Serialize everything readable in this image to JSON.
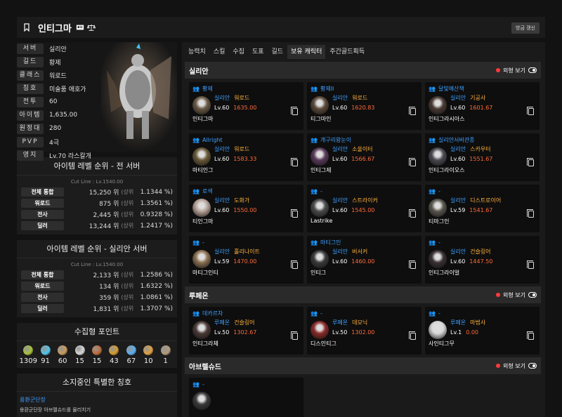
{
  "header": {
    "title": "인티그마",
    "refresh_label": "방금 갱신"
  },
  "profile": {
    "rows": [
      {
        "label": "서버",
        "value": "실리안"
      },
      {
        "label": "길드",
        "value": "황제"
      },
      {
        "label": "클래스",
        "value": "워로드"
      },
      {
        "label": "칭호",
        "value": "미술품 애호가"
      },
      {
        "label": "전투",
        "value": "60"
      },
      {
        "label": "아이템",
        "value": "1,635.00"
      },
      {
        "label": "원정대",
        "value": "280"
      },
      {
        "label": "PVP",
        "value": "4극"
      },
      {
        "label": "영지",
        "value": "Lv.70 라스칼개"
      }
    ]
  },
  "rank_all": {
    "title": "아이템 레벨 순위 - 전 서버",
    "cutline": "Cut Line : Lv.1540.00",
    "rows": [
      {
        "label": "전체 통합",
        "rank": "15,250 위",
        "tier": "(상위",
        "pct": "1.1344 %)"
      },
      {
        "label": "워로드",
        "rank": "875 위",
        "tier": "(상위",
        "pct": "1.3561 %)"
      },
      {
        "label": "전사",
        "rank": "2,445 위",
        "tier": "(상위",
        "pct": "0.9328 %)"
      },
      {
        "label": "딜러",
        "rank": "13,244 위",
        "tier": "(상위",
        "pct": "1.2417 %)"
      }
    ]
  },
  "rank_server": {
    "title": "아이템 레벨 순위 - 실리안 서버",
    "cutline": "Cut Line : Lv.1540.00",
    "rows": [
      {
        "label": "전체 통합",
        "rank": "2,133 위",
        "tier": "(상위",
        "pct": "1.2586 %)"
      },
      {
        "label": "워로드",
        "rank": "134 위",
        "tier": "(상위",
        "pct": "1.6322 %)"
      },
      {
        "label": "전사",
        "rank": "359 위",
        "tier": "(상위",
        "pct": "1.0861 %)"
      },
      {
        "label": "딜러",
        "rank": "1,831 위",
        "tier": "(상위",
        "pct": "1.3707 %)"
      }
    ]
  },
  "collection": {
    "title": "수집형 포인트",
    "items": [
      {
        "icon": "mokoko-seed-icon",
        "color": "#a8c23a",
        "value": "1309"
      },
      {
        "icon": "island-heart-icon",
        "color": "#4fc4e8",
        "value": "91"
      },
      {
        "icon": "masterpiece-icon",
        "color": "#c99a5a",
        "value": "60"
      },
      {
        "icon": "giant-heart-icon",
        "color": "#d7d7d7",
        "value": "15"
      },
      {
        "icon": "ignea-token-icon",
        "color": "#c06a3a",
        "value": "15"
      },
      {
        "icon": "sea-bounty-icon",
        "color": "#d69a2a",
        "value": "43"
      },
      {
        "icon": "world-tree-leaf-icon",
        "color": "#5ab0f0",
        "value": "67"
      },
      {
        "icon": "orpheus-star-icon",
        "color": "#e0a040",
        "value": "10"
      },
      {
        "icon": "omnium-star-icon",
        "color": "#b49a7a",
        "value": "1"
      }
    ]
  },
  "special_titles": {
    "title": "소지중인 특별한 칭호",
    "items": [
      {
        "name": "용환군단장",
        "desc": "용환군단장 아브렐슈드를 물리치기"
      }
    ]
  },
  "tabs": [
    "능력치",
    "스킬",
    "수집",
    "도표",
    "길드",
    "보유 캐릭터",
    "주간골드획득"
  ],
  "active_tab": "보유 캐릭터",
  "view_label": "외형 보기",
  "servers": [
    {
      "name": "실리안",
      "characters": [
        {
          "guild": "황제",
          "server": "실리안",
          "class": "워로드",
          "level": "Lv.60",
          "ilvl": "1635.00",
          "name": "인티그마",
          "avatar_color": "#6a5a46"
        },
        {
          "guild": "황제II",
          "server": "실리안",
          "class": "워로드",
          "level": "Lv.60",
          "ilvl": "1620.83",
          "name": "티그마인",
          "avatar_color": "#5a4a3a"
        },
        {
          "guild": "달빛예산책",
          "server": "실리안",
          "class": "기공사",
          "level": "Lv.60",
          "ilvl": "1601.67",
          "name": "인티그라시아스",
          "avatar_color": "#4a3a34"
        },
        {
          "guild": "Allright",
          "server": "실리안",
          "class": "워로드",
          "level": "Lv.60",
          "ilvl": "1583.33",
          "name": "마티인그",
          "avatar_color": "#6a5a3a"
        },
        {
          "guild": "개구리왕눈이",
          "server": "실리안",
          "class": "소울이터",
          "level": "Lv.60",
          "ilvl": "1566.67",
          "name": "인티그제",
          "avatar_color": "#5a3a5a"
        },
        {
          "guild": "실리안서버관종",
          "server": "실리안",
          "class": "스카우터",
          "level": "Lv.60",
          "ilvl": "1551.67",
          "name": "인티그라이오스",
          "avatar_color": "#4a4a52"
        },
        {
          "guild": "로섹",
          "server": "실리안",
          "class": "도화가",
          "level": "Lv.60",
          "ilvl": "1550.00",
          "name": "티인그마",
          "avatar_color": "#b8a49a"
        },
        {
          "guild": "-",
          "server": "실리안",
          "class": "스트라이커",
          "level": "Lv.60",
          "ilvl": "1545.00",
          "name": "Lastrike",
          "avatar_color": "#4a4a4a"
        },
        {
          "guild": "-",
          "server": "실리안",
          "class": "디스트로이어",
          "level": "Lv.59",
          "ilvl": "1541.67",
          "name": "티마그인",
          "avatar_color": "#5a564e"
        },
        {
          "guild": "-",
          "server": "실리안",
          "class": "홀리나이트",
          "level": "Lv.59",
          "ilvl": "1470.00",
          "name": "마티그인티",
          "avatar_color": "#8a7050"
        },
        {
          "guild": "마티그인",
          "server": "실리안",
          "class": "버서커",
          "level": "Lv.60",
          "ilvl": "1460.00",
          "name": "인티그",
          "avatar_color": "#3a3a3a"
        },
        {
          "guild": "-",
          "server": "실리안",
          "class": "건슬링어",
          "level": "Lv.60",
          "ilvl": "1447.50",
          "name": "인티그라이얼",
          "avatar_color": "#3a3034"
        }
      ]
    },
    {
      "name": "루페온",
      "characters": [
        {
          "guild": "데카르차",
          "server": "루페온",
          "class": "건슬링어",
          "level": "Lv.50",
          "ilvl": "1302.67",
          "name": "인티그라체",
          "avatar_color": "#4a3a36"
        },
        {
          "guild": "-",
          "server": "루페온",
          "class": "데모닉",
          "level": "Lv.50",
          "ilvl": "1302.00",
          "name": "디스인티그",
          "avatar_color": "#8a2a2a"
        },
        {
          "guild": "-",
          "server": "루페온",
          "class": "마법사",
          "level": "Lv.1",
          "ilvl": "0.00",
          "name": "사인티그무",
          "avatar_color": "#d8d8d8"
        }
      ]
    },
    {
      "name": "아브렐슈드",
      "characters": [
        {
          "guild": "-",
          "server": "",
          "class": "",
          "level": "",
          "ilvl": "",
          "name": "",
          "avatar_color": "#3a3a3a"
        }
      ]
    }
  ]
}
